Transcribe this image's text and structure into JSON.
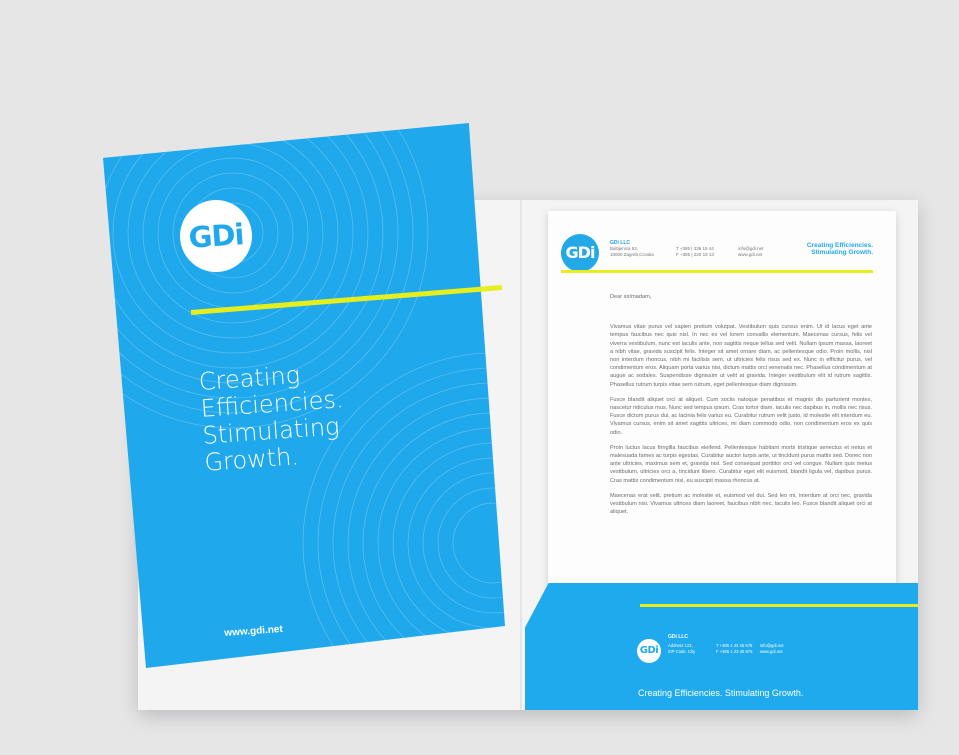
{
  "folder": {
    "cover": {
      "logo_text": "GDi",
      "tagline_lines": [
        "Creating",
        "Efficiencies.",
        "Stimulating",
        "Growth."
      ],
      "website": "www.gdi.net"
    },
    "letterhead": {
      "logo_text": "GDi",
      "company": "GDi LLC",
      "address": "Baltijenica 53,\n10000 Zagreb,Croatia",
      "phone": "T +385 | 336 15 44\nF +385 | 220 19 13",
      "web": "info@gdi.net\nwww.gdi.net",
      "tagline": "Creating Efficiencies.\nStimulating Growth.",
      "salutation": "Dear sir/madam,",
      "paragraphs": [
        "Vivamus vitae purus vel sapien pretium volutpat. Vestibulum quis cursus enim. Ut id lacus eget ante tempus faucibus nec quis nisl. In nec ex vel lorem convallis elementum. Maecenas cursus, felis vel viverra vestibulum, nunc est iaculis ante, non sagittis neque tellus sed velit. Nullam ipsum massa, laoreet a nibh vitae, gravida suscipit felis. Integer sit amet ornare diam, ac pellentesque odio. Proin mollis, nisl non interdum rhoncus, nibh mi facilisis sem, ut ultricies felis risus sed ex. Nunc in efficitur purus, vel condimentum eros. Aliquam porta varius nisi, dictum mattis orci venenatis nec. Phasellus condimentum at augue ac sodales. Suspendisse dignissim ut velit at gravida. Integer vestibulum elit id rutrum sagittis. Phasellus rutrum turpis vitae sem rutrum, eget pellentesque diam dignissim.",
        "Fusce blandit aliquet orci at aliquet. Cum sociis natoque penatibus et magnis dis parturient montes, nascetur ridiculus mus. Nunc sed tempus ipsum. Cras tortor diam, iaculis nec dapibus in, mollis nec risus. Fusce dictum purus dui, ac lacinia felis varius eu. Curabitur rutrum velit justo, id molestie elit interdum eu. Vivamus cursus, enim sit amet sagittis ultrices, mi diam commodo odio, non condimentum eros ex quis odio.",
        "Proin luctus lacus fringilla faucibus eleifend. Pellentesque habitant morbi tristique senectus et netus et malesuada fames ac turpis egestas. Curabitur auctor turpis ante, ut tincidunt purus mattis sed. Donec non ante ultricies, maximus sem et, gravida nisl. Sed consequat porttitor orci vel congue. Nullam quis metus vestibulum, ultricies orci a, tincidunt libero. Curabitur eget elit euismod, blandit ligula vel, dapibus purus. Cras mattis condimentum nisi, eu suscipit massa rhoncus at.",
        "Maecenas erat velit, pretium ac molestie et, euismod vel dui. Sed leo mi, interdum at orci nec, gravida vestibulum nisi. Vivamus ultrices diam laoreet, faucibus nibh nec, iaculis leo. Fusce blandit aliquet orci at aliquet."
      ]
    },
    "pocket": {
      "logo_text": "GDi",
      "company": "GDi LLC",
      "address": "Address 123,\nZIP Code, City",
      "phone": "T +385 1 23 45 678\nF +385 1 23 45 678",
      "web": "info@gdi.net\nwww.gdi.net",
      "tagline": "Creating Efficiencies. Stimulating Growth."
    },
    "colors": {
      "brand_blue": "#1fa9ec",
      "accent_yellow": "#e6ef1c",
      "background": "#e6e6e7"
    }
  }
}
